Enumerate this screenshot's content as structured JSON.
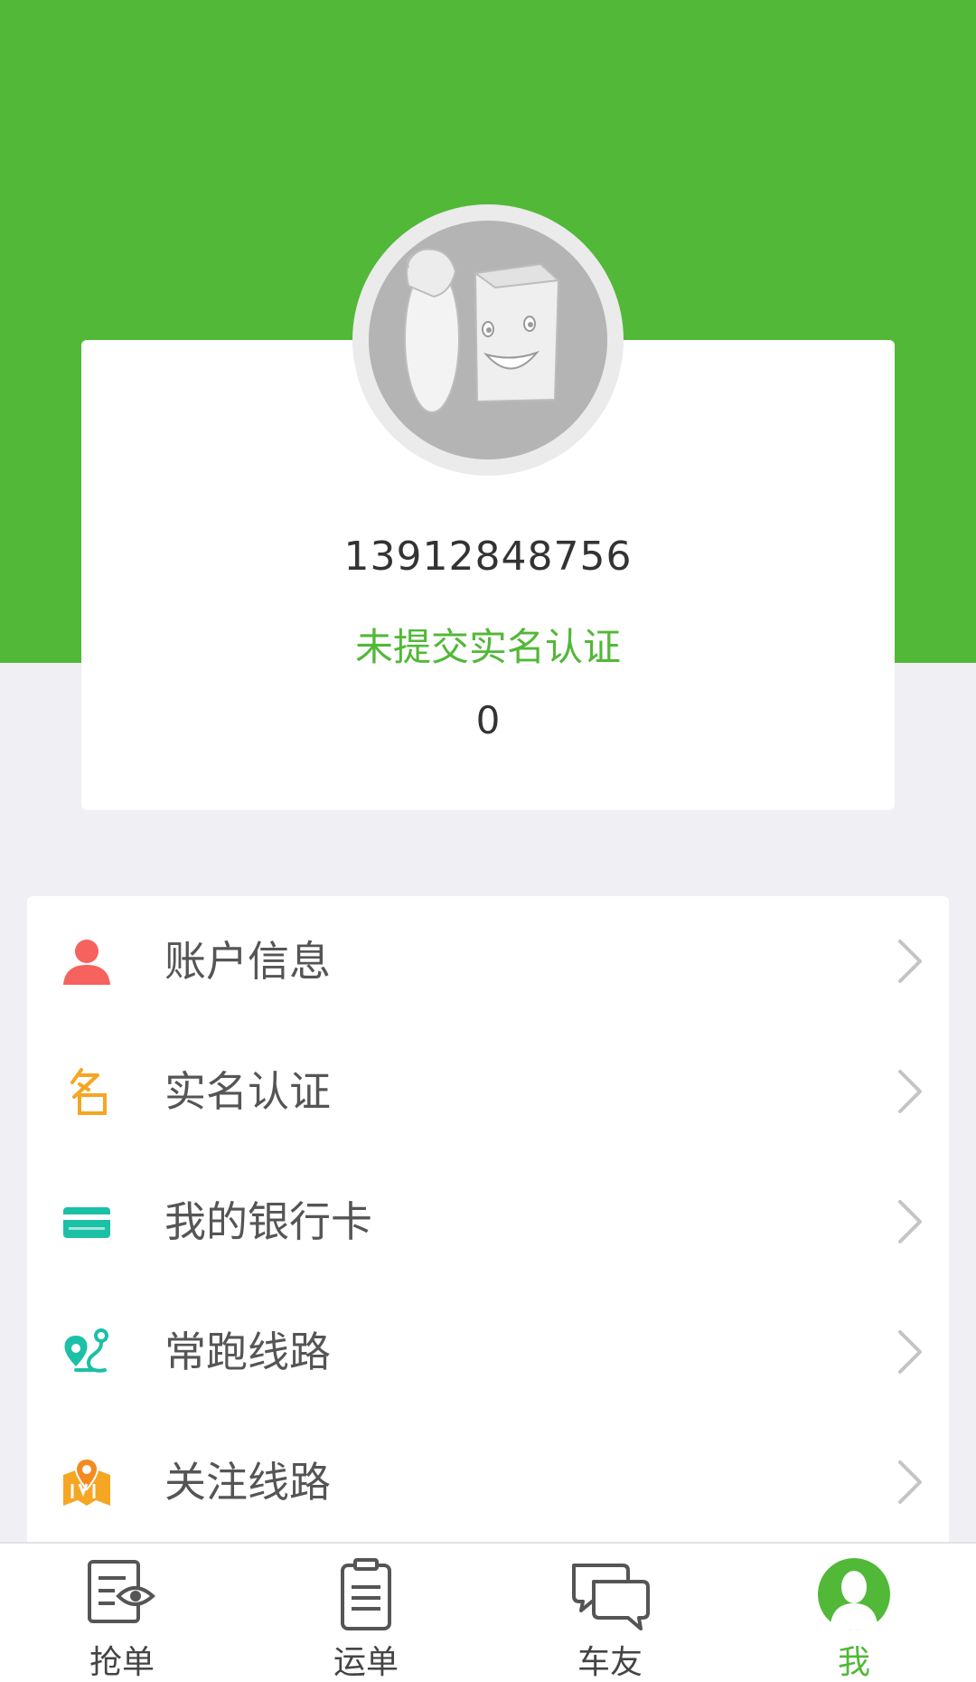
{
  "profile": {
    "phone": "13912848756",
    "verify_status": "未提交实名认证",
    "balance": "0"
  },
  "menu": {
    "items": [
      {
        "label": "账户信息",
        "icon": "person-icon",
        "color": "#f6625e"
      },
      {
        "label": "实名认证",
        "icon": "name-icon",
        "color": "#f5a623"
      },
      {
        "label": "我的银行卡",
        "icon": "bank-card-icon",
        "color": "#1cc0a6"
      },
      {
        "label": "常跑线路",
        "icon": "route-icon",
        "color": "#1cc0a6"
      },
      {
        "label": "关注线路",
        "icon": "map-pin-icon",
        "color": "#f5a623"
      }
    ]
  },
  "nav": {
    "tabs": [
      {
        "label": "抢单",
        "icon": "grab-order-icon",
        "active": false
      },
      {
        "label": "运单",
        "icon": "clipboard-icon",
        "active": false
      },
      {
        "label": "车友",
        "icon": "chat-bubbles-icon",
        "active": false
      },
      {
        "label": "我",
        "icon": "user-avatar-icon",
        "active": true
      }
    ]
  },
  "colors": {
    "brand_green": "#52b838",
    "background": "#efeff4",
    "text_dark": "#333333",
    "chevron": "#c4c4c4"
  }
}
